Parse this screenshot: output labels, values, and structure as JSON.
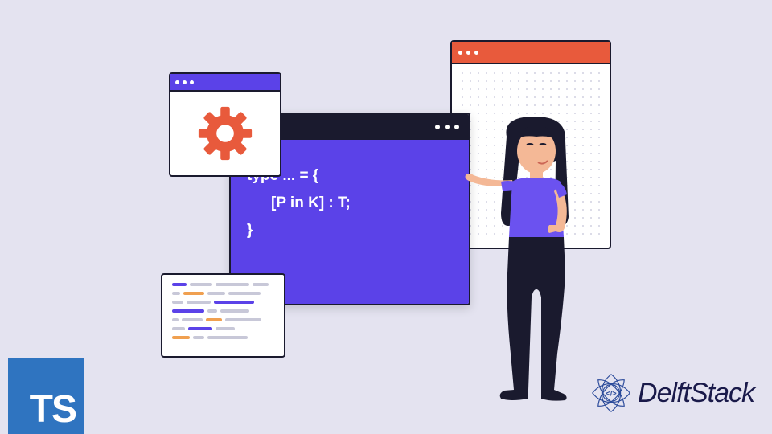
{
  "code": {
    "line1": "type ... = {",
    "line2": "[P in K] : T;",
    "line3": "}"
  },
  "logos": {
    "ts": "TS",
    "delftstack": "DelftStack"
  },
  "colors": {
    "bg": "#e4e3f0",
    "purple": "#5b42e8",
    "orange": "#e85a3c",
    "dark": "#1a1a2e",
    "tsBlue": "#2f74c0"
  }
}
